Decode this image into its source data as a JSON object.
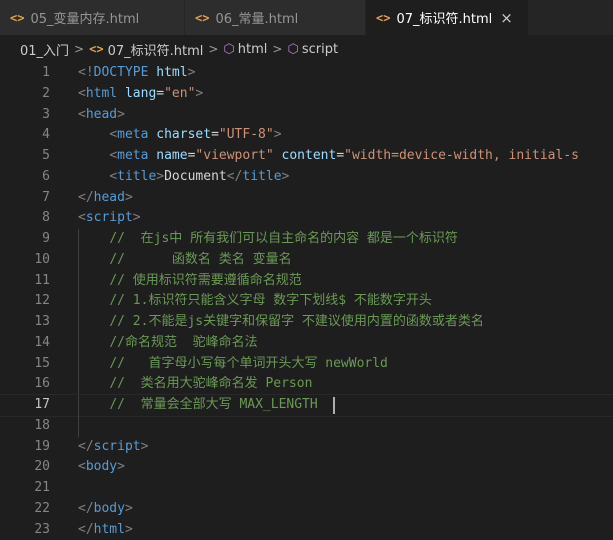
{
  "tabs": [
    {
      "icon": "<>",
      "label": "05_变量内存.html",
      "active": false
    },
    {
      "icon": "<>",
      "label": "06_常量.html",
      "active": false
    },
    {
      "icon": "<>",
      "label": "07_标识符.html",
      "active": true,
      "close": "×"
    }
  ],
  "breadcrumb": {
    "folder": "01_入门",
    "sep": ">",
    "file_icon": "<>",
    "file": "07_标识符.html",
    "item1_icon": "⬡",
    "item1": "html",
    "item2_icon": "⬡",
    "item2": "script"
  },
  "editor": {
    "current_line": 17,
    "lines": [
      {
        "n": "1",
        "tokens": [
          [
            "punc",
            "<!"
          ],
          [
            "tag",
            "DOCTYPE"
          ],
          [
            "text",
            " "
          ],
          [
            "attr",
            "html"
          ],
          [
            "punc",
            ">"
          ]
        ]
      },
      {
        "n": "2",
        "tokens": [
          [
            "punc",
            "<"
          ],
          [
            "tag",
            "html"
          ],
          [
            "text",
            " "
          ],
          [
            "attr",
            "lang"
          ],
          [
            "text",
            "="
          ],
          [
            "str",
            "\"en\""
          ],
          [
            "punc",
            ">"
          ]
        ]
      },
      {
        "n": "3",
        "tokens": [
          [
            "punc",
            "<"
          ],
          [
            "tag",
            "head"
          ],
          [
            "punc",
            ">"
          ]
        ]
      },
      {
        "n": "4",
        "tokens": [
          [
            "text",
            "    "
          ],
          [
            "punc",
            "<"
          ],
          [
            "tag",
            "meta"
          ],
          [
            "text",
            " "
          ],
          [
            "attr",
            "charset"
          ],
          [
            "text",
            "="
          ],
          [
            "str",
            "\"UTF-8\""
          ],
          [
            "punc",
            ">"
          ]
        ]
      },
      {
        "n": "5",
        "tokens": [
          [
            "text",
            "    "
          ],
          [
            "punc",
            "<"
          ],
          [
            "tag",
            "meta"
          ],
          [
            "text",
            " "
          ],
          [
            "attr",
            "name"
          ],
          [
            "text",
            "="
          ],
          [
            "str",
            "\"viewport\""
          ],
          [
            "text",
            " "
          ],
          [
            "attr",
            "content"
          ],
          [
            "text",
            "="
          ],
          [
            "str",
            "\"width=device-width, initial-s"
          ]
        ]
      },
      {
        "n": "6",
        "tokens": [
          [
            "text",
            "    "
          ],
          [
            "punc",
            "<"
          ],
          [
            "tag",
            "title"
          ],
          [
            "punc",
            ">"
          ],
          [
            "text",
            "Document"
          ],
          [
            "punc",
            "</"
          ],
          [
            "tag",
            "title"
          ],
          [
            "punc",
            ">"
          ]
        ]
      },
      {
        "n": "7",
        "tokens": [
          [
            "punc",
            "</"
          ],
          [
            "tag",
            "head"
          ],
          [
            "punc",
            ">"
          ]
        ]
      },
      {
        "n": "8",
        "tokens": [
          [
            "punc",
            "<"
          ],
          [
            "tag",
            "script"
          ],
          [
            "punc",
            ">"
          ]
        ]
      },
      {
        "n": "9",
        "tokens": [
          [
            "text",
            "    "
          ],
          [
            "com",
            "//  在js中 所有我们可以自主命名的内容 都是一个标识符"
          ]
        ]
      },
      {
        "n": "10",
        "tokens": [
          [
            "text",
            "    "
          ],
          [
            "com",
            "//      函数名 类名 变量名"
          ]
        ]
      },
      {
        "n": "11",
        "tokens": [
          [
            "text",
            "    "
          ],
          [
            "com",
            "// 使用标识符需要遵循命名规范"
          ]
        ]
      },
      {
        "n": "12",
        "tokens": [
          [
            "text",
            "    "
          ],
          [
            "com",
            "// 1.标识符只能含义字母 数字下划线$ 不能数字开头"
          ]
        ]
      },
      {
        "n": "13",
        "tokens": [
          [
            "text",
            "    "
          ],
          [
            "com",
            "// 2.不能是js关键字和保留字 不建议使用内置的函数或者类名"
          ]
        ]
      },
      {
        "n": "14",
        "tokens": [
          [
            "text",
            "    "
          ],
          [
            "com",
            "//命名规范  驼峰命名法"
          ]
        ]
      },
      {
        "n": "15",
        "tokens": [
          [
            "text",
            "    "
          ],
          [
            "com",
            "//   首字母小写每个单词开头大写 newWorld"
          ]
        ]
      },
      {
        "n": "16",
        "tokens": [
          [
            "text",
            "    "
          ],
          [
            "com",
            "//  类名用大驼峰命名发 Person"
          ]
        ]
      },
      {
        "n": "17",
        "tokens": [
          [
            "text",
            "    "
          ],
          [
            "com",
            "//  常量会全部大写 MAX_LENGTH"
          ]
        ]
      },
      {
        "n": "18",
        "tokens": []
      },
      {
        "n": "19",
        "tokens": [
          [
            "punc",
            "</"
          ],
          [
            "tag",
            "script"
          ],
          [
            "punc",
            ">"
          ]
        ]
      },
      {
        "n": "20",
        "tokens": [
          [
            "punc",
            "<"
          ],
          [
            "tag",
            "body"
          ],
          [
            "punc",
            ">"
          ]
        ]
      },
      {
        "n": "21",
        "tokens": []
      },
      {
        "n": "22",
        "tokens": [
          [
            "punc",
            "</"
          ],
          [
            "tag",
            "body"
          ],
          [
            "punc",
            ">"
          ]
        ]
      },
      {
        "n": "23",
        "tokens": [
          [
            "punc",
            "</"
          ],
          [
            "tag",
            "html"
          ],
          [
            "punc",
            ">"
          ]
        ]
      }
    ]
  },
  "colors": {
    "background": "#1e1e1e",
    "tab_inactive": "#2d2d2d",
    "html_icon": "#e5a44a",
    "tag": "#569cd6",
    "attribute": "#9cdcfe",
    "string": "#ce9178",
    "comment": "#6a9955"
  }
}
